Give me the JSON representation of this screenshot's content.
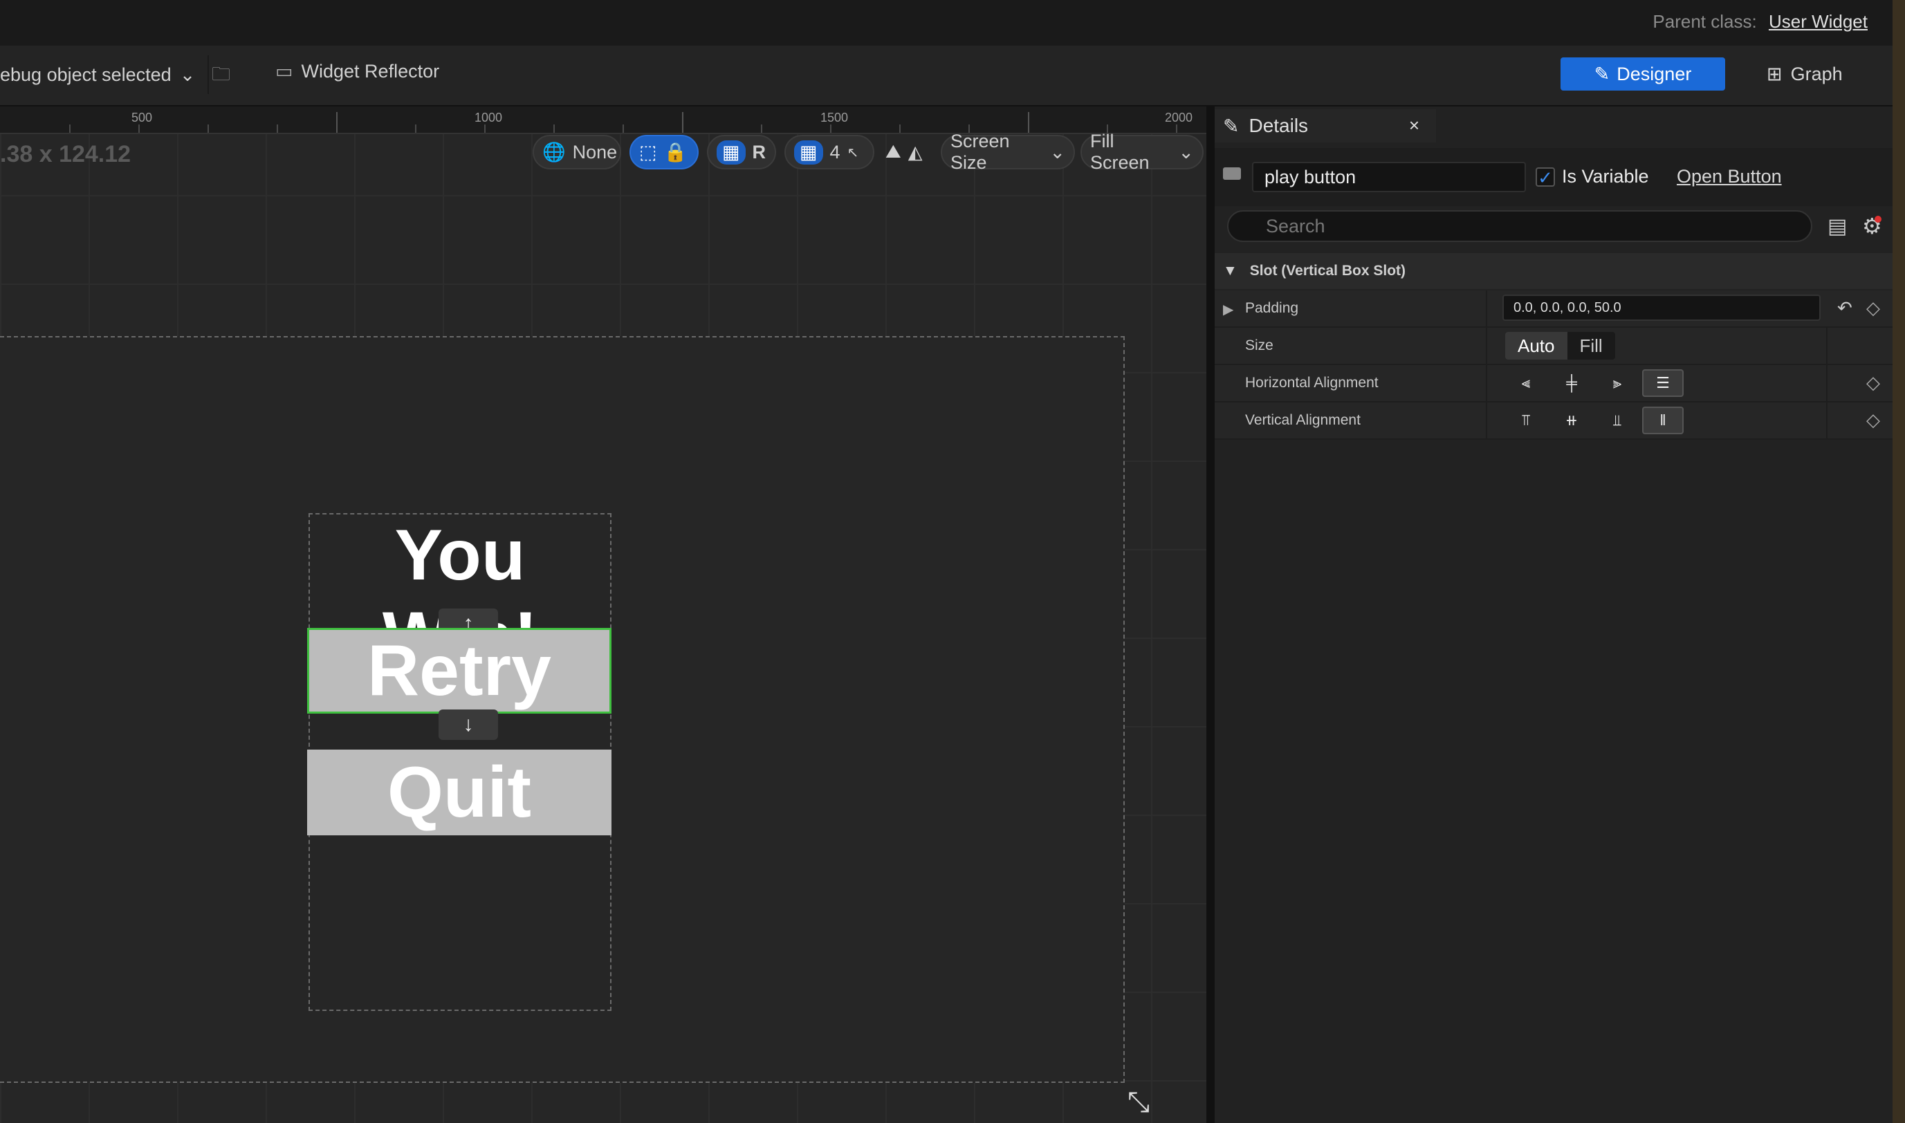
{
  "window": {
    "parent_class_label": "Parent class:",
    "parent_class_value": "User Widget"
  },
  "toolbar": {
    "debug_dropdown": "ebug object selected",
    "widget_reflector": "Widget Reflector",
    "designer_label": "Designer",
    "graph_label": "Graph"
  },
  "ruler": {
    "labels": [
      "500",
      "1000",
      "1500",
      "2000"
    ]
  },
  "canvas": {
    "size_readout": ".38 x 124.12",
    "localization_value": "None",
    "rotation_label": "R",
    "grid_snap_value": "4",
    "screen_size_label": "Screen Size",
    "fill_screen_label": "Fill Screen"
  },
  "widget": {
    "title": "You Win!",
    "retry_label": "Retry",
    "quit_label": "Quit",
    "move_up_arrow": "↑",
    "move_down_arrow": "↓"
  },
  "details": {
    "tab_label": "Details",
    "close_glyph": "×",
    "name_value": "play button",
    "is_variable_label": "Is Variable",
    "is_variable_checked": true,
    "open_button_label": "Open Button",
    "search_placeholder": "Search",
    "section_title": "Slot (Vertical Box Slot)",
    "properties": {
      "padding": {
        "label": "Padding",
        "value": "0.0, 0.0, 0.0, 50.0"
      },
      "size": {
        "label": "Size",
        "options": [
          "Auto",
          "Fill"
        ],
        "selected": "Auto"
      },
      "horizontal_alignment": {
        "label": "Horizontal Alignment",
        "selected": "fill"
      },
      "vertical_alignment": {
        "label": "Vertical Alignment",
        "selected": "fill"
      }
    }
  },
  "colors": {
    "accent": "#1b6ad8",
    "selection_outline": "#3fbf3f",
    "button_fill": "#bcbcbc"
  }
}
